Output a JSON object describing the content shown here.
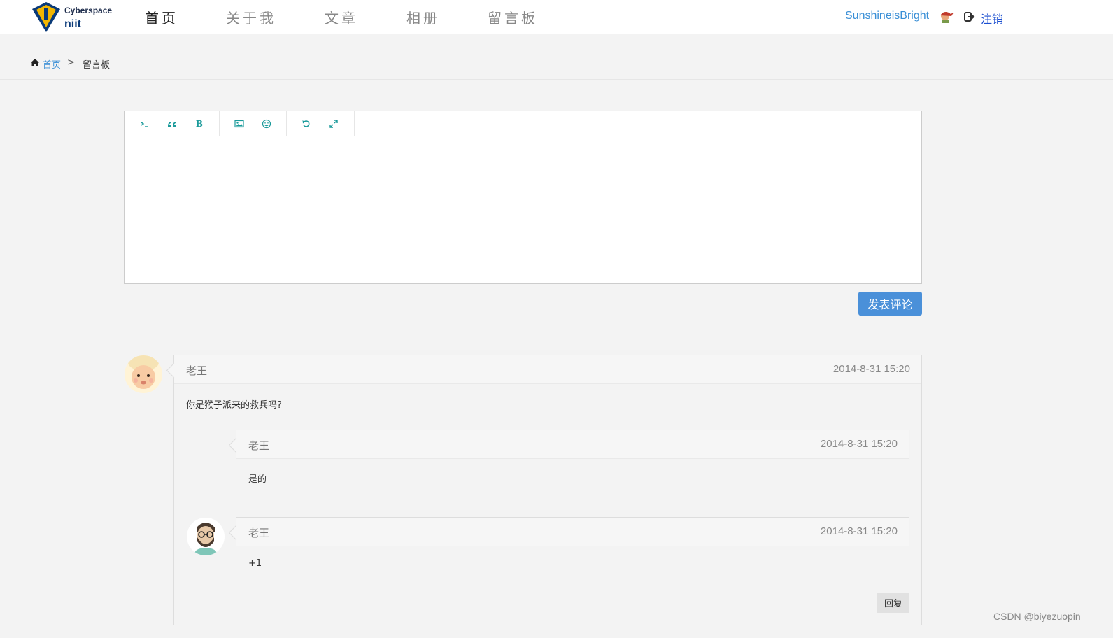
{
  "header": {
    "logo_line1": "Cyberspace",
    "logo_line2": "niit",
    "nav": [
      "首页",
      "关于我",
      "文章",
      "相册",
      "留言板"
    ],
    "username": "SunshineisBright",
    "logout": "注销"
  },
  "breadcrumb": {
    "home": "首页",
    "separator": ">",
    "current": "留言板"
  },
  "editor": {
    "toolbar_icons": [
      "code-icon",
      "quote-icon",
      "bold-icon",
      "image-icon",
      "emoji-icon",
      "undo-icon",
      "fullscreen-icon"
    ],
    "bold_glyph": "B",
    "submit": "发表评论"
  },
  "comments": {
    "main": {
      "author": "老王",
      "time": "2014-8-31 15:20",
      "text": "你是猴子派来的救兵吗?"
    },
    "reply1": {
      "author": "老王",
      "time": "2014-8-31 15:20",
      "text": "是的"
    },
    "reply2": {
      "author": "老王",
      "time": "2014-8-31 15:20",
      "text": "+1"
    },
    "reply_button": "回复"
  },
  "watermark": "CSDN @biyezuopin",
  "colors": {
    "link": "#3a8fd6",
    "button": "#4a90d9",
    "toolbar_icon": "#1a9a9a"
  }
}
